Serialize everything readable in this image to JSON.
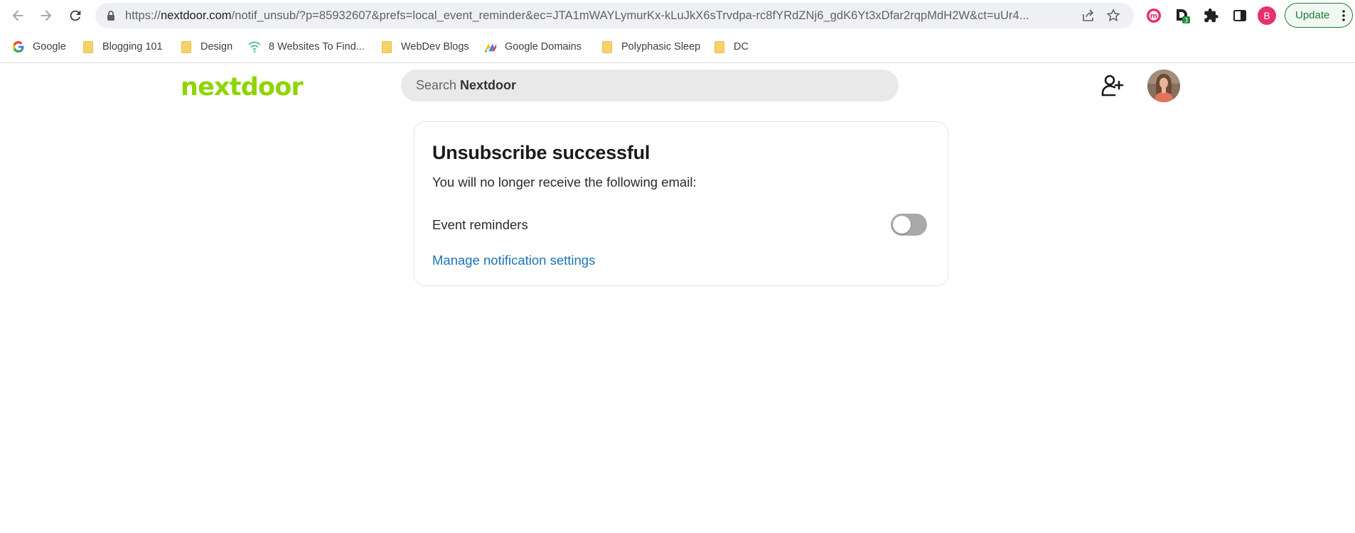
{
  "browser": {
    "url_prefix": "https://",
    "url_host": "nextdoor.com",
    "url_path": "/notif_unsub/?p=85932607&prefs=local_event_reminder&ec=JTA1mWAYLymurKx-kLuJkX6sTrvdpa-rc8fYRdZNj6_gdK6Yt3xDfar2rqpMdH2W&ct=uUr4...",
    "extension_badge": "3",
    "profile_initial": "B",
    "update_label": "Update"
  },
  "bookmarks": [
    {
      "label": "Google",
      "icon": "google-icon"
    },
    {
      "label": "Blogging 101",
      "icon": "folder-icon"
    },
    {
      "label": "Design",
      "icon": "folder-icon"
    },
    {
      "label": "8 Websites To Find...",
      "icon": "wifi-icon"
    },
    {
      "label": "WebDev Blogs",
      "icon": "folder-icon"
    },
    {
      "label": "Google Domains",
      "icon": "google-domains-icon"
    },
    {
      "label": "Polyphasic Sleep",
      "icon": "folder-icon"
    },
    {
      "label": "DC",
      "icon": "folder-icon"
    }
  ],
  "header": {
    "logo": "nextdoor",
    "search_prefix": "Search",
    "search_brand": "Nextdoor"
  },
  "card": {
    "title": "Unsubscribe successful",
    "subtitle": "You will no longer receive the following email:",
    "pref_label": "Event reminders",
    "pref_enabled": false,
    "manage_link": "Manage notification settings"
  },
  "colors": {
    "brand_green": "#8ed500",
    "link_blue": "#1f73b7",
    "toggle_off": "#a9a9a9"
  }
}
